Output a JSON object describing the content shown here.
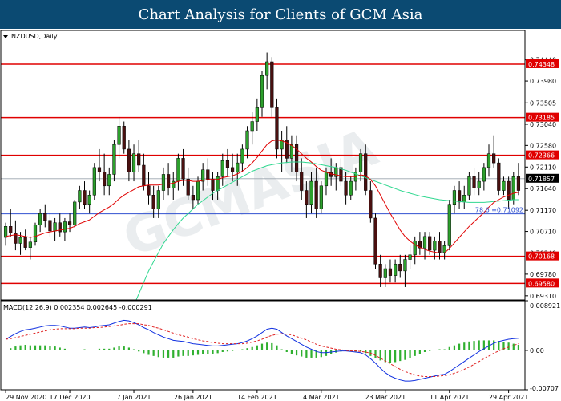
{
  "banner": {
    "title": "Chart Analysis for Clients of GCM Asia"
  },
  "chart_data": {
    "type": "candlestick",
    "symbol_label": "NZDUSD,Daily",
    "watermark": "GCMASIA",
    "x_tick_labels": [
      "29 Nov 2020",
      "17 Dec 2020",
      "7 Jan 2021",
      "26 Jan 2021",
      "14 Feb 2021",
      "4 Mar 2021",
      "23 Mar 2021",
      "11 Apr 2021",
      "29 Apr 2021"
    ],
    "y_ticks": [
      0.7444,
      0.7398,
      0.73505,
      0.7304,
      0.7258,
      0.7211,
      0.7164,
      0.7117,
      0.7071,
      0.7024,
      0.6978,
      0.6931
    ],
    "ylim": [
      0.6922,
      0.7508
    ],
    "last_price": {
      "value": 0.71857,
      "label": "0.71857"
    },
    "levels": [
      {
        "value": 0.74348,
        "label": "0.74348",
        "color": "#e00000"
      },
      {
        "value": 0.73185,
        "label": "0.73185",
        "color": "#e00000"
      },
      {
        "value": 0.72366,
        "label": "0.72366",
        "color": "#e00000"
      },
      {
        "value": 0.70168,
        "label": "0.70168",
        "color": "#e00000"
      },
      {
        "value": 0.6958,
        "label": "0.69580",
        "color": "#e00000"
      }
    ],
    "fib_level": {
      "value": 0.71092,
      "label": "78.6 =0.71092",
      "color": "#3050d0"
    },
    "candles": [
      [
        0.7058,
        0.709,
        0.704,
        0.7082
      ],
      [
        0.7082,
        0.712,
        0.706,
        0.7068
      ],
      [
        0.7068,
        0.7095,
        0.703,
        0.7045
      ],
      [
        0.7045,
        0.707,
        0.702,
        0.7058
      ],
      [
        0.7058,
        0.7075,
        0.703,
        0.7036
      ],
      [
        0.7036,
        0.706,
        0.701,
        0.7048
      ],
      [
        0.7048,
        0.709,
        0.704,
        0.7085
      ],
      [
        0.7085,
        0.712,
        0.707,
        0.711
      ],
      [
        0.711,
        0.713,
        0.708,
        0.7095
      ],
      [
        0.7095,
        0.711,
        0.706,
        0.7072
      ],
      [
        0.7072,
        0.71,
        0.705,
        0.709
      ],
      [
        0.709,
        0.711,
        0.706,
        0.707
      ],
      [
        0.707,
        0.71,
        0.705,
        0.7092
      ],
      [
        0.7092,
        0.711,
        0.707,
        0.7085
      ],
      [
        0.7085,
        0.714,
        0.708,
        0.7135
      ],
      [
        0.7135,
        0.717,
        0.712,
        0.716
      ],
      [
        0.716,
        0.718,
        0.712,
        0.713
      ],
      [
        0.713,
        0.716,
        0.711,
        0.715
      ],
      [
        0.715,
        0.722,
        0.714,
        0.721
      ],
      [
        0.721,
        0.725,
        0.718,
        0.72
      ],
      [
        0.72,
        0.724,
        0.715,
        0.717
      ],
      [
        0.717,
        0.721,
        0.715,
        0.7195
      ],
      [
        0.7195,
        0.727,
        0.718,
        0.726
      ],
      [
        0.726,
        0.732,
        0.723,
        0.73
      ],
      [
        0.73,
        0.731,
        0.724,
        0.725
      ],
      [
        0.725,
        0.727,
        0.718,
        0.72
      ],
      [
        0.72,
        0.726,
        0.718,
        0.724
      ],
      [
        0.724,
        0.727,
        0.72,
        0.7215
      ],
      [
        0.7215,
        0.724,
        0.716,
        0.717
      ],
      [
        0.717,
        0.72,
        0.713,
        0.715
      ],
      [
        0.715,
        0.717,
        0.71,
        0.712
      ],
      [
        0.712,
        0.717,
        0.71,
        0.716
      ],
      [
        0.716,
        0.721,
        0.714,
        0.7195
      ],
      [
        0.7195,
        0.722,
        0.715,
        0.7165
      ],
      [
        0.7165,
        0.72,
        0.714,
        0.718
      ],
      [
        0.718,
        0.724,
        0.716,
        0.723
      ],
      [
        0.723,
        0.725,
        0.717,
        0.7185
      ],
      [
        0.7185,
        0.721,
        0.714,
        0.715
      ],
      [
        0.715,
        0.717,
        0.712,
        0.714
      ],
      [
        0.714,
        0.719,
        0.713,
        0.718
      ],
      [
        0.718,
        0.722,
        0.716,
        0.7205
      ],
      [
        0.7205,
        0.723,
        0.717,
        0.7185
      ],
      [
        0.7185,
        0.72,
        0.714,
        0.716
      ],
      [
        0.716,
        0.72,
        0.714,
        0.719
      ],
      [
        0.719,
        0.724,
        0.717,
        0.7225
      ],
      [
        0.7225,
        0.725,
        0.719,
        0.721
      ],
      [
        0.721,
        0.724,
        0.718,
        0.72
      ],
      [
        0.72,
        0.724,
        0.717,
        0.722
      ],
      [
        0.722,
        0.726,
        0.72,
        0.725
      ],
      [
        0.725,
        0.73,
        0.723,
        0.729
      ],
      [
        0.729,
        0.733,
        0.726,
        0.731
      ],
      [
        0.731,
        0.736,
        0.729,
        0.734
      ],
      [
        0.734,
        0.742,
        0.732,
        0.741
      ],
      [
        0.741,
        0.746,
        0.738,
        0.744
      ],
      [
        0.744,
        0.745,
        0.732,
        0.734
      ],
      [
        0.734,
        0.736,
        0.723,
        0.725
      ],
      [
        0.725,
        0.729,
        0.72,
        0.727
      ],
      [
        0.727,
        0.73,
        0.722,
        0.723
      ],
      [
        0.723,
        0.728,
        0.72,
        0.726
      ],
      [
        0.726,
        0.728,
        0.718,
        0.72
      ],
      [
        0.72,
        0.723,
        0.714,
        0.716
      ],
      [
        0.716,
        0.718,
        0.71,
        0.713
      ],
      [
        0.713,
        0.72,
        0.711,
        0.718
      ],
      [
        0.718,
        0.721,
        0.71,
        0.712
      ],
      [
        0.712,
        0.718,
        0.711,
        0.717
      ],
      [
        0.717,
        0.721,
        0.715,
        0.72
      ],
      [
        0.72,
        0.723,
        0.717,
        0.719
      ],
      [
        0.719,
        0.722,
        0.716,
        0.721
      ],
      [
        0.721,
        0.723,
        0.717,
        0.718
      ],
      [
        0.718,
        0.72,
        0.713,
        0.715
      ],
      [
        0.715,
        0.719,
        0.714,
        0.718
      ],
      [
        0.718,
        0.721,
        0.716,
        0.72
      ],
      [
        0.72,
        0.725,
        0.718,
        0.724
      ],
      [
        0.724,
        0.726,
        0.715,
        0.716
      ],
      [
        0.716,
        0.718,
        0.709,
        0.71
      ],
      [
        0.71,
        0.711,
        0.699,
        0.7
      ],
      [
        0.7,
        0.702,
        0.695,
        0.697
      ],
      [
        0.697,
        0.7,
        0.695,
        0.699
      ],
      [
        0.699,
        0.701,
        0.696,
        0.6975
      ],
      [
        0.6975,
        0.701,
        0.696,
        0.7
      ],
      [
        0.7,
        0.702,
        0.697,
        0.6985
      ],
      [
        0.6985,
        0.702,
        0.695,
        0.701
      ],
      [
        0.701,
        0.704,
        0.699,
        0.702
      ],
      [
        0.702,
        0.706,
        0.7,
        0.705
      ],
      [
        0.705,
        0.707,
        0.702,
        0.7035
      ],
      [
        0.7035,
        0.707,
        0.701,
        0.706
      ],
      [
        0.706,
        0.707,
        0.702,
        0.703
      ],
      [
        0.703,
        0.706,
        0.701,
        0.705
      ],
      [
        0.705,
        0.707,
        0.701,
        0.7025
      ],
      [
        0.7025,
        0.705,
        0.701,
        0.704
      ],
      [
        0.704,
        0.714,
        0.703,
        0.713
      ],
      [
        0.713,
        0.717,
        0.711,
        0.716
      ],
      [
        0.716,
        0.718,
        0.712,
        0.7135
      ],
      [
        0.7135,
        0.717,
        0.712,
        0.715
      ],
      [
        0.715,
        0.72,
        0.714,
        0.719
      ],
      [
        0.719,
        0.721,
        0.715,
        0.7165
      ],
      [
        0.7165,
        0.72,
        0.715,
        0.718
      ],
      [
        0.718,
        0.722,
        0.716,
        0.721
      ],
      [
        0.721,
        0.726,
        0.719,
        0.724
      ],
      [
        0.724,
        0.728,
        0.721,
        0.722
      ],
      [
        0.722,
        0.723,
        0.715,
        0.716
      ],
      [
        0.716,
        0.719,
        0.715,
        0.718
      ],
      [
        0.718,
        0.719,
        0.712,
        0.714
      ],
      [
        0.714,
        0.72,
        0.713,
        0.719
      ],
      [
        0.719,
        0.722,
        0.715,
        0.716
      ]
    ],
    "ma_fast": {
      "color": "#e00000",
      "values": [
        0.706,
        0.7062,
        0.7064,
        0.7062,
        0.706,
        0.7058,
        0.706,
        0.7064,
        0.7068,
        0.707,
        0.7072,
        0.7074,
        0.7076,
        0.7078,
        0.7082,
        0.7088,
        0.7092,
        0.7096,
        0.7104,
        0.7112,
        0.7118,
        0.7124,
        0.7132,
        0.7142,
        0.715,
        0.7156,
        0.7162,
        0.7168,
        0.717,
        0.7172,
        0.7172,
        0.7172,
        0.7174,
        0.7174,
        0.7176,
        0.718,
        0.7182,
        0.7182,
        0.718,
        0.718,
        0.7182,
        0.7184,
        0.7184,
        0.7184,
        0.7188,
        0.719,
        0.7192,
        0.7196,
        0.7202,
        0.721,
        0.722,
        0.7232,
        0.7246,
        0.726,
        0.7268,
        0.727,
        0.7268,
        0.7264,
        0.7258,
        0.725,
        0.724,
        0.723,
        0.7222,
        0.7212,
        0.7204,
        0.72,
        0.7196,
        0.7194,
        0.7192,
        0.719,
        0.719,
        0.719,
        0.7194,
        0.7192,
        0.7184,
        0.717,
        0.715,
        0.713,
        0.711,
        0.7092,
        0.7074,
        0.706,
        0.705,
        0.7042,
        0.7036,
        0.7032,
        0.7028,
        0.7026,
        0.7024,
        0.7024,
        0.7034,
        0.7046,
        0.7058,
        0.707,
        0.7082,
        0.7092,
        0.7102,
        0.7112,
        0.7124,
        0.7134,
        0.714,
        0.7146,
        0.715,
        0.7154,
        0.7156
      ]
    },
    "ma_slow": {
      "color": "#30d890",
      "values": [
        null,
        null,
        null,
        null,
        null,
        null,
        null,
        null,
        null,
        null,
        null,
        null,
        null,
        null,
        null,
        null,
        null,
        null,
        null,
        null,
        null,
        null,
        null,
        null,
        null,
        null,
        0.691,
        0.6935,
        0.696,
        0.6985,
        0.7005,
        0.7025,
        0.7045,
        0.706,
        0.7075,
        0.7088,
        0.71,
        0.711,
        0.712,
        0.713,
        0.7138,
        0.7146,
        0.7154,
        0.716,
        0.7166,
        0.7172,
        0.7178,
        0.7184,
        0.719,
        0.7196,
        0.7202,
        0.7206,
        0.721,
        0.7214,
        0.7216,
        0.7218,
        0.722,
        0.7221,
        0.7222,
        0.7222,
        0.7222,
        0.7221,
        0.722,
        0.7218,
        0.7216,
        0.7214,
        0.7212,
        0.721,
        0.7207,
        0.7204,
        0.72,
        0.7196,
        0.7192,
        0.7188,
        0.7184,
        0.718,
        0.7176,
        0.7172,
        0.7168,
        0.7164,
        0.716,
        0.7157,
        0.7154,
        0.7151,
        0.7148,
        0.7146,
        0.7144,
        0.7142,
        0.714,
        0.7139,
        0.7138,
        0.7137,
        0.7136,
        0.7135,
        0.7134,
        0.7134,
        0.7134,
        0.7134,
        0.7135,
        0.7136,
        0.7137,
        0.7138,
        0.7139,
        0.714,
        0.714
      ]
    },
    "macd": {
      "label": "MACD(12,26,9) 0.002354 0.002645 -0.000291",
      "y_ticks": [
        {
          "value": 0.008921,
          "label": "0.008921"
        },
        {
          "value": 0.0,
          "label": "0.00"
        },
        {
          "value": -0.00707,
          "label": "-0.00707"
        }
      ],
      "ylim": [
        -0.00707,
        0.008921
      ],
      "macd_color": "#1030e0",
      "signal_color": "#e02020",
      "hist_color": "#30b030",
      "macd": [
        0.002,
        0.0025,
        0.003,
        0.0034,
        0.0037,
        0.0038,
        0.004,
        0.0042,
        0.0044,
        0.0045,
        0.0045,
        0.0044,
        0.0042,
        0.004,
        0.004,
        0.0041,
        0.0042,
        0.0041,
        0.0042,
        0.0044,
        0.0045,
        0.0046,
        0.0049,
        0.0052,
        0.0054,
        0.0053,
        0.005,
        0.0046,
        0.0041,
        0.0037,
        0.0032,
        0.0028,
        0.0024,
        0.0021,
        0.0018,
        0.0017,
        0.0016,
        0.0014,
        0.0012,
        0.0011,
        0.001,
        0.0009,
        0.0008,
        0.0008,
        0.0009,
        0.001,
        0.0011,
        0.0012,
        0.0014,
        0.0017,
        0.0021,
        0.0026,
        0.0032,
        0.0038,
        0.004,
        0.0038,
        0.0032,
        0.0026,
        0.0021,
        0.0016,
        0.0011,
        0.0006,
        0.0002,
        -0.0002,
        -0.0004,
        -0.0004,
        -0.0003,
        -0.0002,
        -0.0001,
        -0.0001,
        -0.0002,
        -0.0003,
        -0.0004,
        -0.0008,
        -0.0015,
        -0.0023,
        -0.0032,
        -0.004,
        -0.0046,
        -0.005,
        -0.0053,
        -0.0055,
        -0.0055,
        -0.0054,
        -0.0052,
        -0.005,
        -0.0048,
        -0.0046,
        -0.0044,
        -0.0043,
        -0.0038,
        -0.0032,
        -0.0026,
        -0.002,
        -0.0014,
        -0.0008,
        -0.0002,
        0.0003,
        0.0008,
        0.0013,
        0.0016,
        0.0018,
        0.002,
        0.0021,
        0.0022
      ],
      "signal": [
        0.002,
        0.0021,
        0.0023,
        0.0025,
        0.0027,
        0.0029,
        0.0031,
        0.0033,
        0.0035,
        0.0037,
        0.0038,
        0.0039,
        0.0039,
        0.0039,
        0.0039,
        0.004,
        0.004,
        0.004,
        0.0041,
        0.0041,
        0.0042,
        0.0043,
        0.0044,
        0.0045,
        0.0047,
        0.0048,
        0.0048,
        0.0048,
        0.0046,
        0.0045,
        0.0042,
        0.004,
        0.0037,
        0.0034,
        0.0031,
        0.0028,
        0.0026,
        0.0024,
        0.0021,
        0.0019,
        0.0017,
        0.0016,
        0.0014,
        0.0013,
        0.0012,
        0.0012,
        0.0012,
        0.0012,
        0.0012,
        0.0013,
        0.0015,
        0.0017,
        0.002,
        0.0024,
        0.0027,
        0.0029,
        0.003,
        0.0029,
        0.0028,
        0.0025,
        0.0022,
        0.0019,
        0.0015,
        0.0011,
        0.0008,
        0.0006,
        0.0004,
        0.0002,
        0.0001,
        0.0,
        -0.0001,
        -0.0001,
        -0.0002,
        -0.0003,
        -0.0005,
        -0.0009,
        -0.0014,
        -0.0019,
        -0.0024,
        -0.0029,
        -0.0034,
        -0.0038,
        -0.0041,
        -0.0044,
        -0.0046,
        -0.0047,
        -0.0047,
        -0.0047,
        -0.0046,
        -0.0045,
        -0.0044,
        -0.0041,
        -0.0038,
        -0.0034,
        -0.003,
        -0.0025,
        -0.002,
        -0.0015,
        -0.001,
        -0.0005,
        -0.0001,
        0.0003,
        0.0006,
        0.0009,
        0.0012
      ]
    }
  }
}
